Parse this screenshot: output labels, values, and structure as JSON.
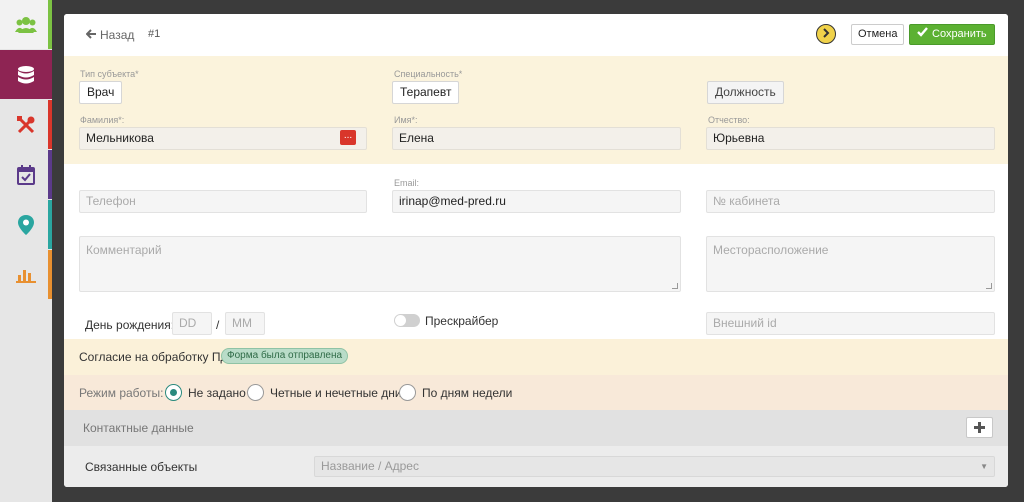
{
  "sidebar": {
    "items": [
      {
        "icon": "users-icon",
        "color": "#7cc243"
      },
      {
        "icon": "database-icon",
        "color": "#8e2453"
      },
      {
        "icon": "tools-icon",
        "color": "#d9362b"
      },
      {
        "icon": "calendar-icon",
        "color": "#5b3a8a"
      },
      {
        "icon": "map-pin-icon",
        "color": "#2aa6a0"
      },
      {
        "icon": "bar-chart-icon",
        "color": "#e89030"
      }
    ]
  },
  "header": {
    "back_label": "Назад",
    "record_id": "#1",
    "cancel_label": "Отмена",
    "save_label": "Сохранить"
  },
  "subject": {
    "type_label": "Тип субъекта*",
    "type_value": "Врач",
    "specialty_label": "Специальность*",
    "specialty_value": "Терапевт",
    "position_label": "Должность",
    "surname_label": "Фамилия*:",
    "surname_value": "Мельникова",
    "name_label": "Имя*:",
    "name_value": "Елена",
    "patronymic_label": "Отчество:",
    "patronymic_value": "Юрьевна"
  },
  "contacts": {
    "phone_placeholder": "Телефон",
    "email_label": "Email:",
    "email_value": "irinap@med-pred.ru",
    "office_placeholder": "№ кабинета",
    "comment_placeholder": "Комментарий",
    "location_placeholder": "Месторасположение",
    "birthday_label": "День рождения:",
    "day_placeholder": "DD",
    "separator": "/",
    "month_placeholder": "MM",
    "prescriber_label": "Прескрайбер",
    "external_id_placeholder": "Внешний id"
  },
  "consent": {
    "label": "Согласие на обработку ПД",
    "badge": "Форма была отправлена"
  },
  "work_mode": {
    "label": "Режим работы:",
    "options": [
      {
        "label": "Не задано",
        "checked": true
      },
      {
        "label": "Четные и нечетные дни",
        "checked": false
      },
      {
        "label": "По дням недели",
        "checked": false
      }
    ]
  },
  "contact_data": {
    "title": "Контактные данные"
  },
  "linked": {
    "title": "Связанные объекты",
    "select_placeholder": "Название / Адрес"
  }
}
